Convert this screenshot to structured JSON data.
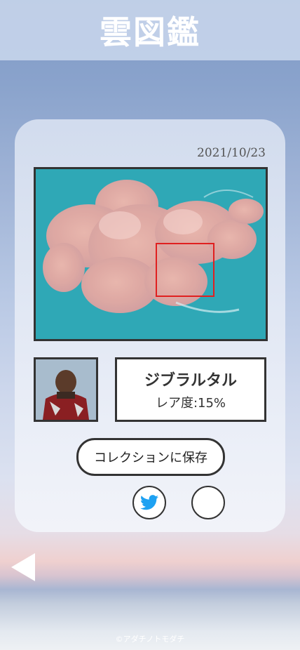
{
  "header": {
    "title": "雲図鑑"
  },
  "card": {
    "date": "2021/10/23",
    "result": {
      "name": "ジブラルタル",
      "rarity": "レア度:15%"
    },
    "save_label": "コレクションに保存"
  },
  "footer": {
    "copyright": "©アダチノトモダチ"
  },
  "icons": {
    "share": "twitter-icon",
    "back": "back-arrow-icon"
  },
  "colors": {
    "twitter": "#1da1f2",
    "highlight_box": "#e02020"
  }
}
